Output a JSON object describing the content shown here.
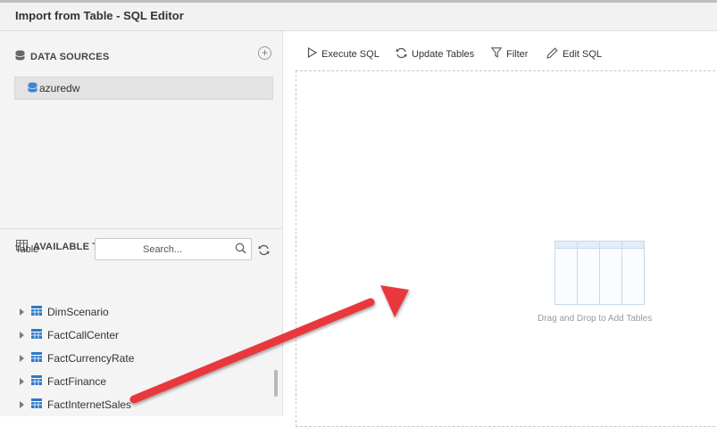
{
  "window": {
    "title": "Import from Table - SQL Editor"
  },
  "data_sources": {
    "heading": "DATA SOURCES",
    "items": [
      {
        "label": "azuredw"
      }
    ]
  },
  "available_tables": {
    "heading": "AVAILABLE TABLES",
    "table_label": "Table",
    "search_placeholder": "Search...",
    "items": [
      {
        "label": "DimScenario"
      },
      {
        "label": "FactCallCenter"
      },
      {
        "label": "FactCurrencyRate"
      },
      {
        "label": "FactFinance"
      },
      {
        "label": "FactInternetSales"
      }
    ]
  },
  "toolbar": {
    "execute_sql": "Execute SQL",
    "update_tables": "Update Tables",
    "filter": "Filter",
    "edit_sql": "Edit SQL"
  },
  "canvas": {
    "placeholder": "Drag and Drop to Add Tables"
  },
  "colors": {
    "db_icon_blue": "#3a86d4",
    "table_icon_blue": "#2f78c8",
    "arrow_red": "#e8383d"
  },
  "icons": {
    "data_sources": "database-icon",
    "available_tables": "grid-icon",
    "execute": "play-icon",
    "update": "refresh-icon",
    "filter": "funnel-icon",
    "edit": "pencil-icon"
  }
}
